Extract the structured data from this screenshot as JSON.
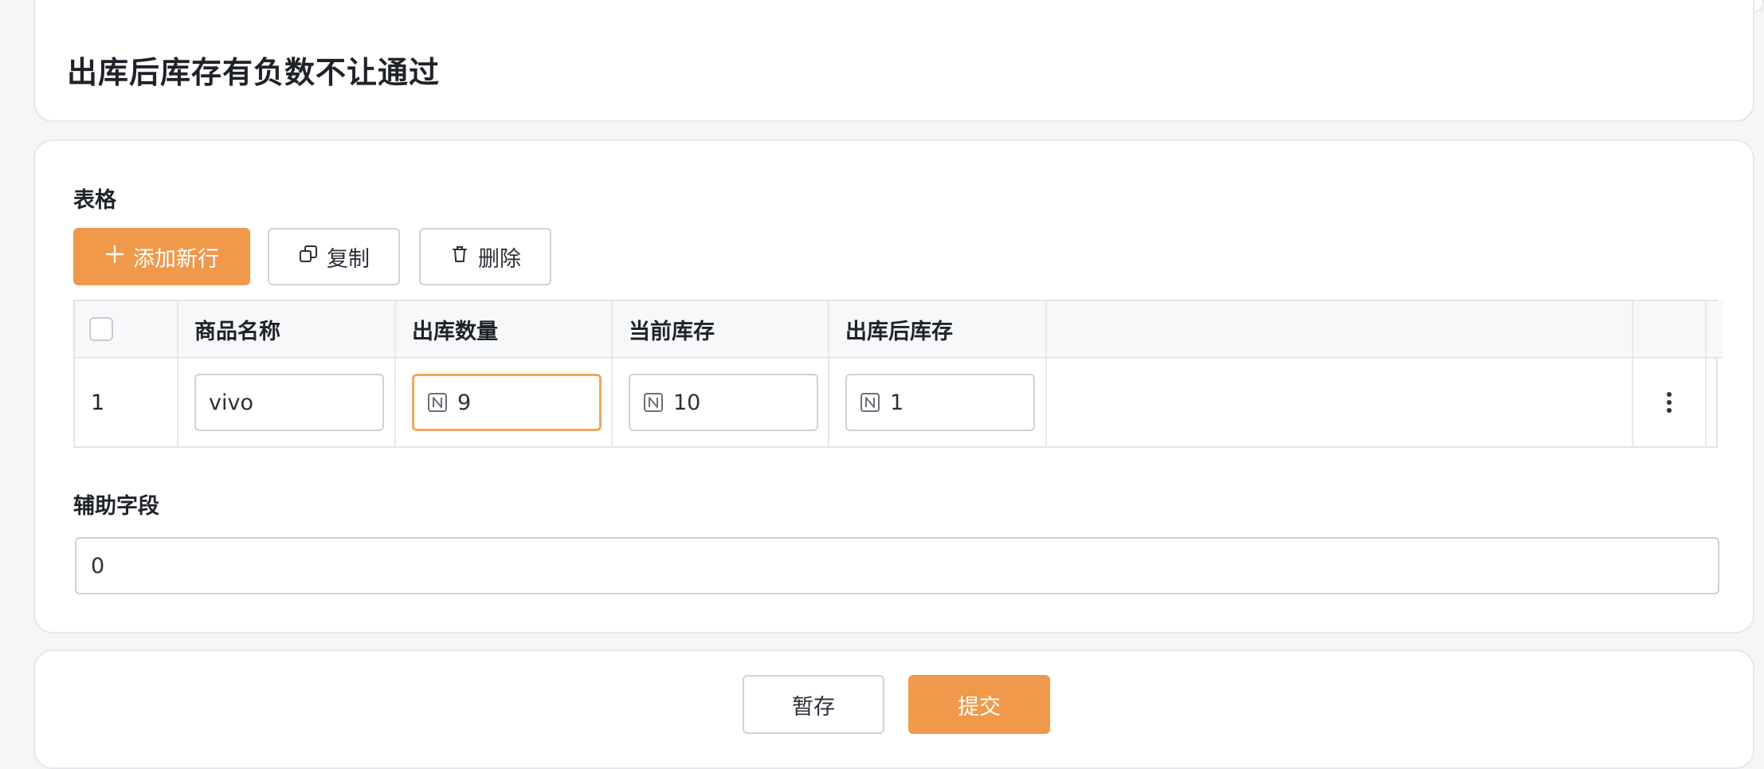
{
  "page": {
    "title": "出库后库存有负数不让通过"
  },
  "form": {
    "table_label": "表格",
    "toolbar": {
      "add_label": "添加新行",
      "copy_label": "复制",
      "delete_label": "删除"
    },
    "table": {
      "columns": [
        "商品名称",
        "出库数量",
        "当前库存",
        "出库后库存"
      ],
      "rows": [
        {
          "index": "1",
          "product_name": "vivo",
          "out_qty": "9",
          "current_stock": "10",
          "stock_after": "1"
        }
      ]
    },
    "aux_label": "辅助字段",
    "aux_value": "0"
  },
  "footer": {
    "save_label": "暂存",
    "submit_label": "提交"
  },
  "colors": {
    "primary": "#f0994a",
    "focus_border": "#f0a65f",
    "border": "#cdd1d8"
  },
  "icons": {
    "add": "plus-icon",
    "copy": "copy-icon",
    "delete": "trash-icon",
    "number": "number-field-icon",
    "more": "more-vertical-icon"
  }
}
